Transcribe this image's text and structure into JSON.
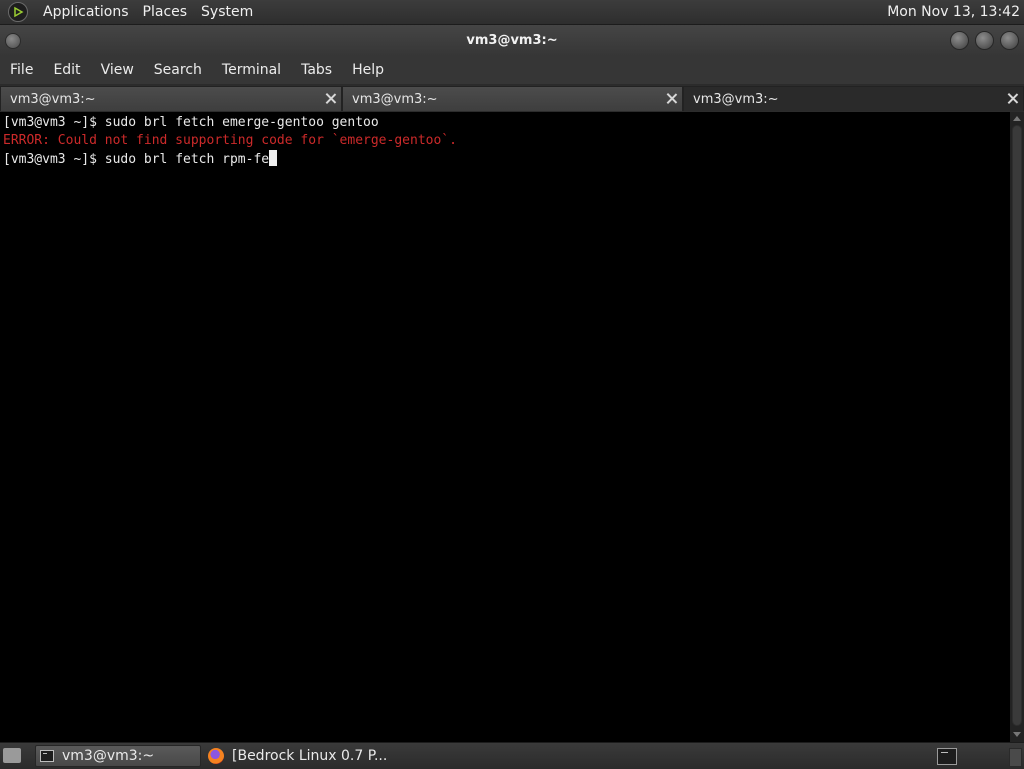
{
  "top_panel": {
    "menus": [
      "Applications",
      "Places",
      "System"
    ],
    "clock": "Mon Nov 13, 13:42"
  },
  "window": {
    "title": "vm3@vm3:~",
    "menu": [
      "File",
      "Edit",
      "View",
      "Search",
      "Terminal",
      "Tabs",
      "Help"
    ],
    "tabs": [
      {
        "label": "vm3@vm3:~",
        "active": false
      },
      {
        "label": "vm3@vm3:~",
        "active": false
      },
      {
        "label": "vm3@vm3:~",
        "active": true
      }
    ]
  },
  "terminal": {
    "lines": [
      {
        "prompt": "[vm3@vm3 ~]$ ",
        "text": "sudo brl fetch emerge-gentoo gentoo",
        "type": "command"
      },
      {
        "prompt": "",
        "text": "ERROR: Could not find supporting code for `emerge-gentoo`.",
        "type": "error"
      },
      {
        "prompt": "[vm3@vm3 ~]$ ",
        "text": "sudo brl fetch rpm-fe",
        "type": "command"
      }
    ],
    "colors": {
      "background": "#000000",
      "foreground": "#e9e9e9",
      "error": "#cc2a2a"
    }
  },
  "taskbar": {
    "items": [
      {
        "label": "vm3@vm3:~",
        "icon": "terminal-icon",
        "active": true
      },
      {
        "label": "[Bedrock Linux 0.7 P...",
        "icon": "firefox-icon",
        "active": false
      }
    ]
  }
}
